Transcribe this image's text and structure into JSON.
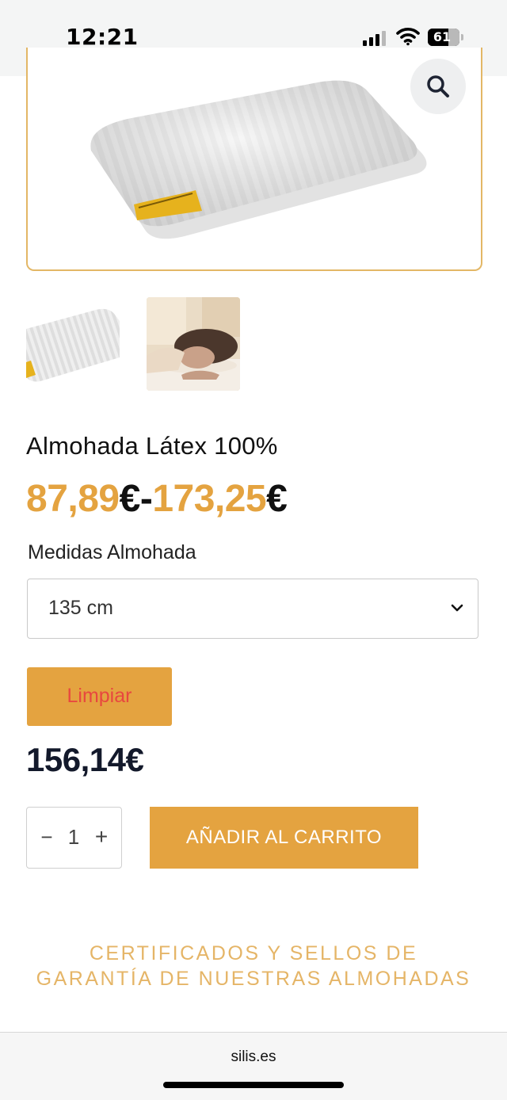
{
  "status_bar": {
    "time": "12:21",
    "battery": "61"
  },
  "product": {
    "title": "Almohada Látex 100%",
    "price_min": "87,89",
    "price_max": "173,25",
    "currency_symbol": "€",
    "range_separator": "-",
    "variation_label": "Medidas Almohada",
    "selected_size": "135 cm",
    "clear_label": "Limpiar",
    "variation_price": "156,14€",
    "quantity": "1",
    "qty_minus": "−",
    "qty_plus": "+",
    "add_to_cart_label": "AÑADIR AL CARRITO"
  },
  "section": {
    "heading_line1": "CERTIFICADOS Y SELLOS DE",
    "heading_line2": "GARANTÍA DE NUESTRAS ALMOHADAS"
  },
  "browser": {
    "url": "silis.es"
  },
  "colors": {
    "accent": "#e4a340",
    "heading_gold": "#e5b567",
    "clear_text": "#e8473f",
    "price_dark": "#13192b"
  },
  "icons": [
    "signal-icon",
    "wifi-icon",
    "battery-icon",
    "zoom-icon",
    "chevron-down-icon"
  ]
}
